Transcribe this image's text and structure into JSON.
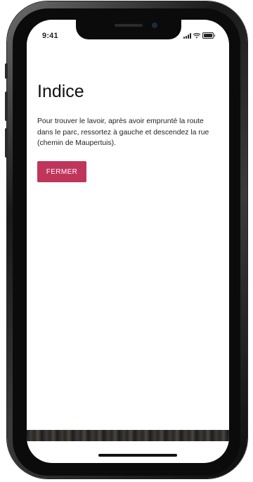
{
  "status_bar": {
    "time": "9:41"
  },
  "hint": {
    "title": "Indice",
    "text": "Pour trouver le lavoir, après avoir emprunté la route dans le parc, ressortez à gauche et descendez la rue (chemin de Maupertuis).",
    "close_label": "FERMER"
  },
  "colors": {
    "accent": "#c0355b",
    "text": "#222222",
    "background": "#ffffff"
  },
  "icons": [
    "signal-icon",
    "wifi-icon",
    "battery-icon"
  ]
}
